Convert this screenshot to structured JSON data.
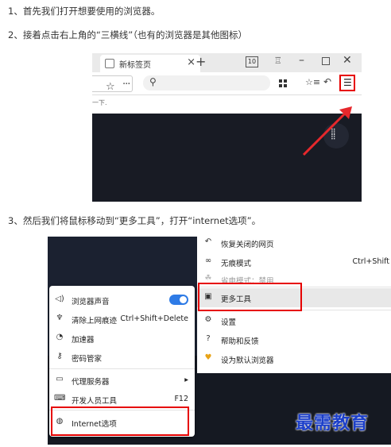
{
  "steps": {
    "s1": "1、首先我们打开想要使用的浏览器。",
    "s2": "2、接着点击右上角的“三横线”（也有的浏览器是其他图标）",
    "s3": "3、然后我们将鼠标移动到“更多工具”，打开“internet选项”。"
  },
  "browser": {
    "tab_title": "新标签页",
    "tab_count": "10",
    "page_hint": "一下."
  },
  "main_menu": {
    "items": [
      {
        "icon": "undo-icon",
        "label": "恢复关闭的网页",
        "shortcut": ""
      },
      {
        "icon": "mask-icon",
        "label": "无痕模式",
        "shortcut": "Ctrl+Shift"
      },
      {
        "icon": "leaf-icon",
        "label": "省电模式：禁用",
        "shortcut": ""
      },
      {
        "icon": "toolbox-icon",
        "label": "更多工具",
        "shortcut": ""
      },
      {
        "icon": "gear-icon",
        "label": "设置",
        "shortcut": ""
      },
      {
        "icon": "help-icon",
        "label": "帮助和反馈",
        "shortcut": ""
      },
      {
        "icon": "thumb-icon",
        "label": "设为默认浏览器",
        "shortcut": ""
      }
    ]
  },
  "tools_menu": {
    "items": [
      {
        "icon": "speaker-icon",
        "label": "浏览器声音",
        "shortcut": ""
      },
      {
        "icon": "broom-icon",
        "label": "清除上网痕迹",
        "shortcut": "Ctrl+Shift+Delete"
      },
      {
        "icon": "speedometer-icon",
        "label": "加速器",
        "shortcut": ""
      },
      {
        "icon": "key-icon",
        "label": "密码管家",
        "shortcut": ""
      },
      {
        "icon": "proxy-icon",
        "label": "代理服务器",
        "shortcut": "▸"
      },
      {
        "icon": "devtools-icon",
        "label": "开发人员工具",
        "shortcut": "F12"
      },
      {
        "icon": "globe-icon",
        "label": "Internet选项",
        "shortcut": ""
      }
    ]
  },
  "watermark": "最需教育"
}
